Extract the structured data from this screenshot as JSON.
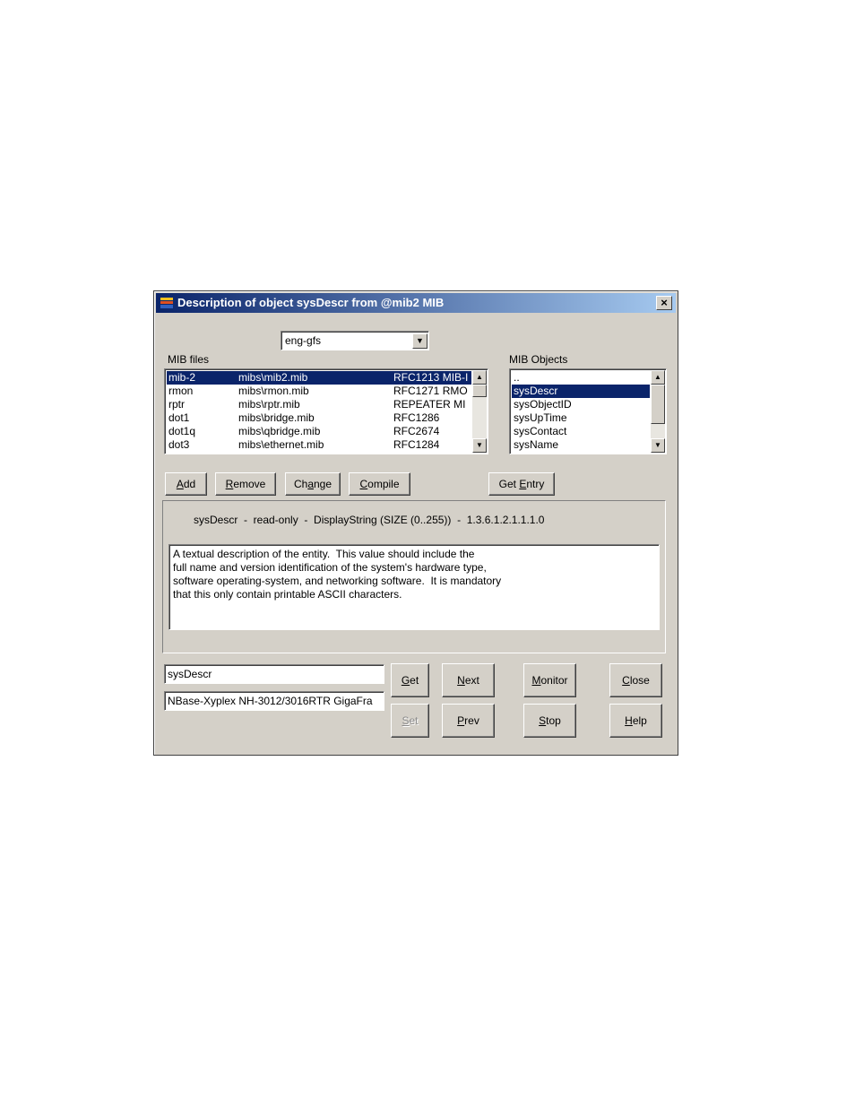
{
  "window": {
    "title": "Description of object sysDescr from @mib2 MIB",
    "close_label": "×"
  },
  "profile_select": {
    "value": "eng-gfs"
  },
  "mib_files": {
    "label": "MIB files",
    "rows": [
      {
        "name": "mib-2",
        "path": "mibs\\mib2.mib",
        "rfc": "RFC1213 MIB-I",
        "selected": true
      },
      {
        "name": "rmon",
        "path": "mibs\\rmon.mib",
        "rfc": "RFC1271 RMO",
        "selected": false
      },
      {
        "name": "rptr",
        "path": "mibs\\rptr.mib",
        "rfc": "REPEATER MI",
        "selected": false
      },
      {
        "name": "dot1",
        "path": "mibs\\bridge.mib",
        "rfc": "RFC1286",
        "selected": false
      },
      {
        "name": "dot1q",
        "path": "mibs\\qbridge.mib",
        "rfc": "RFC2674",
        "selected": false
      },
      {
        "name": "dot3",
        "path": "mibs\\ethernet.mib",
        "rfc": "RFC1284",
        "selected": false
      }
    ]
  },
  "mib_objects": {
    "label": "MIB Objects",
    "items": [
      {
        "name": "..",
        "selected": false
      },
      {
        "name": "sysDescr",
        "selected": true
      },
      {
        "name": "sysObjectID",
        "selected": false
      },
      {
        "name": "sysUpTime",
        "selected": false
      },
      {
        "name": "sysContact",
        "selected": false
      },
      {
        "name": "sysName",
        "selected": false
      }
    ]
  },
  "buttons": {
    "add": {
      "pre": "",
      "accel": "A",
      "post": "dd"
    },
    "remove": {
      "pre": "",
      "accel": "R",
      "post": "emove"
    },
    "change": {
      "pre": "Ch",
      "accel": "a",
      "post": "nge"
    },
    "compile": {
      "pre": "",
      "accel": "C",
      "post": "ompile"
    },
    "get_entry": {
      "pre": "Get ",
      "accel": "E",
      "post": "ntry"
    },
    "get": {
      "pre": "",
      "accel": "G",
      "post": "et"
    },
    "next": {
      "pre": "",
      "accel": "N",
      "post": "ext"
    },
    "monitor": {
      "pre": "",
      "accel": "M",
      "post": "onitor"
    },
    "close": {
      "pre": "",
      "accel": "C",
      "post": "lose"
    },
    "set": {
      "pre": "",
      "accel": "S",
      "post": "et"
    },
    "prev": {
      "pre": "",
      "accel": "P",
      "post": "rev"
    },
    "stop": {
      "pre": "",
      "accel": "S",
      "post": "top"
    },
    "help": {
      "pre": "",
      "accel": "H",
      "post": "elp"
    }
  },
  "object_info": {
    "summary": "sysDescr  -  read-only  -  DisplayString (SIZE (0..255))  -  1.3.6.1.2.1.1.1.0",
    "description_lines": [
      "A textual description of the entity.  This value should include the",
      "full name and version identification of the system's hardware type,",
      "software operating-system, and networking software.  It is mandatory",
      "that this only contain printable ASCII characters."
    ]
  },
  "oid_input": {
    "value": "sysDescr"
  },
  "value_input": {
    "value": "NBase-Xyplex NH-3012/3016RTR GigaFra"
  }
}
